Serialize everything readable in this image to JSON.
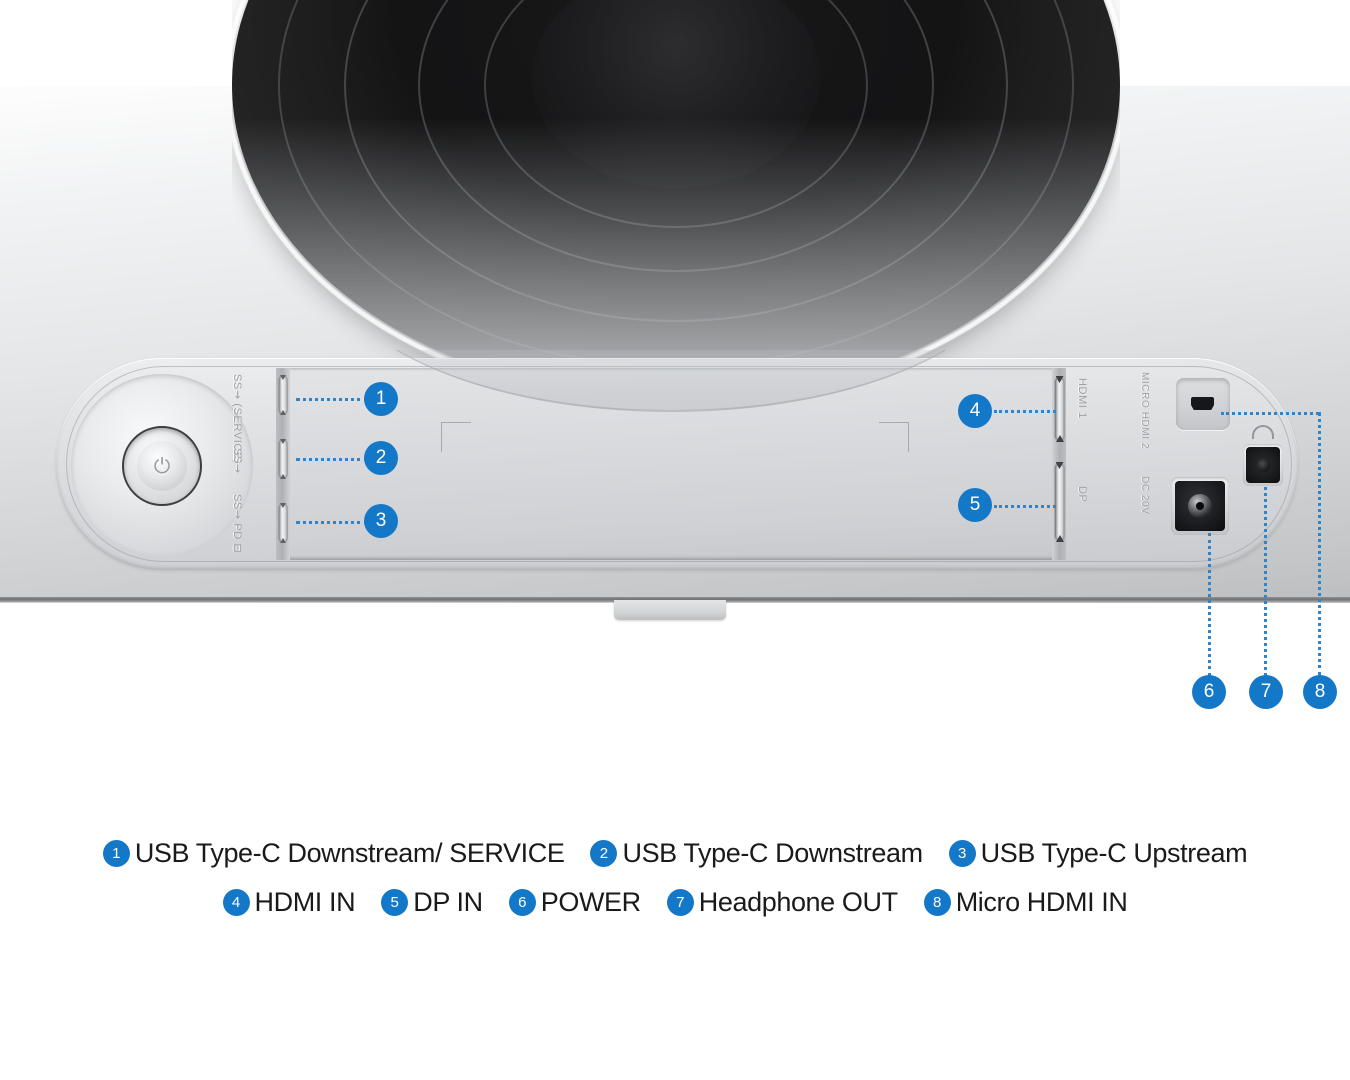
{
  "product": {
    "view": "Monitor rear ports and connections diagram",
    "accent_color": "#1478c8",
    "leader_color": "#2e85cc",
    "body_color": "#d8dadd",
    "hinge_color": "#161617"
  },
  "controls": {
    "power_button_glyph": "⏻",
    "power_button_name": "power-button"
  },
  "silkscreen_labels": [
    {
      "id": "silk-1",
      "text": "SS⇝ (SERVICE)"
    },
    {
      "id": "silk-2",
      "text": "SS⇝"
    },
    {
      "id": "silk-3",
      "text": "SS⇝ PD  ⊡"
    },
    {
      "id": "silk-4",
      "text": "HDMI 1"
    },
    {
      "id": "silk-5",
      "text": "DP"
    },
    {
      "id": "silk-6",
      "text": "MICRO HDMI 2"
    },
    {
      "id": "silk-7",
      "text": "DC 20V"
    }
  ],
  "callouts": [
    {
      "num": "1",
      "target": "usb-c-downstream-service-port"
    },
    {
      "num": "2",
      "target": "usb-c-downstream-port"
    },
    {
      "num": "3",
      "target": "usb-c-upstream-port"
    },
    {
      "num": "4",
      "target": "hdmi-in-port"
    },
    {
      "num": "5",
      "target": "dp-in-port"
    },
    {
      "num": "6",
      "target": "power-dc-jack"
    },
    {
      "num": "7",
      "target": "headphone-out-jack"
    },
    {
      "num": "8",
      "target": "micro-hdmi-in-port"
    }
  ],
  "legend": {
    "row1": [
      {
        "num": "1",
        "label": "USB Type-C Downstream/ SERVICE"
      },
      {
        "num": "2",
        "label": "USB Type-C Downstream"
      },
      {
        "num": "3",
        "label": "USB Type-C Upstream"
      }
    ],
    "row2": [
      {
        "num": "4",
        "label": "HDMI IN"
      },
      {
        "num": "5",
        "label": "DP IN"
      },
      {
        "num": "6",
        "label": "POWER"
      },
      {
        "num": "7",
        "label": "Headphone OUT"
      },
      {
        "num": "8",
        "label": "Micro HDMI IN"
      }
    ]
  }
}
